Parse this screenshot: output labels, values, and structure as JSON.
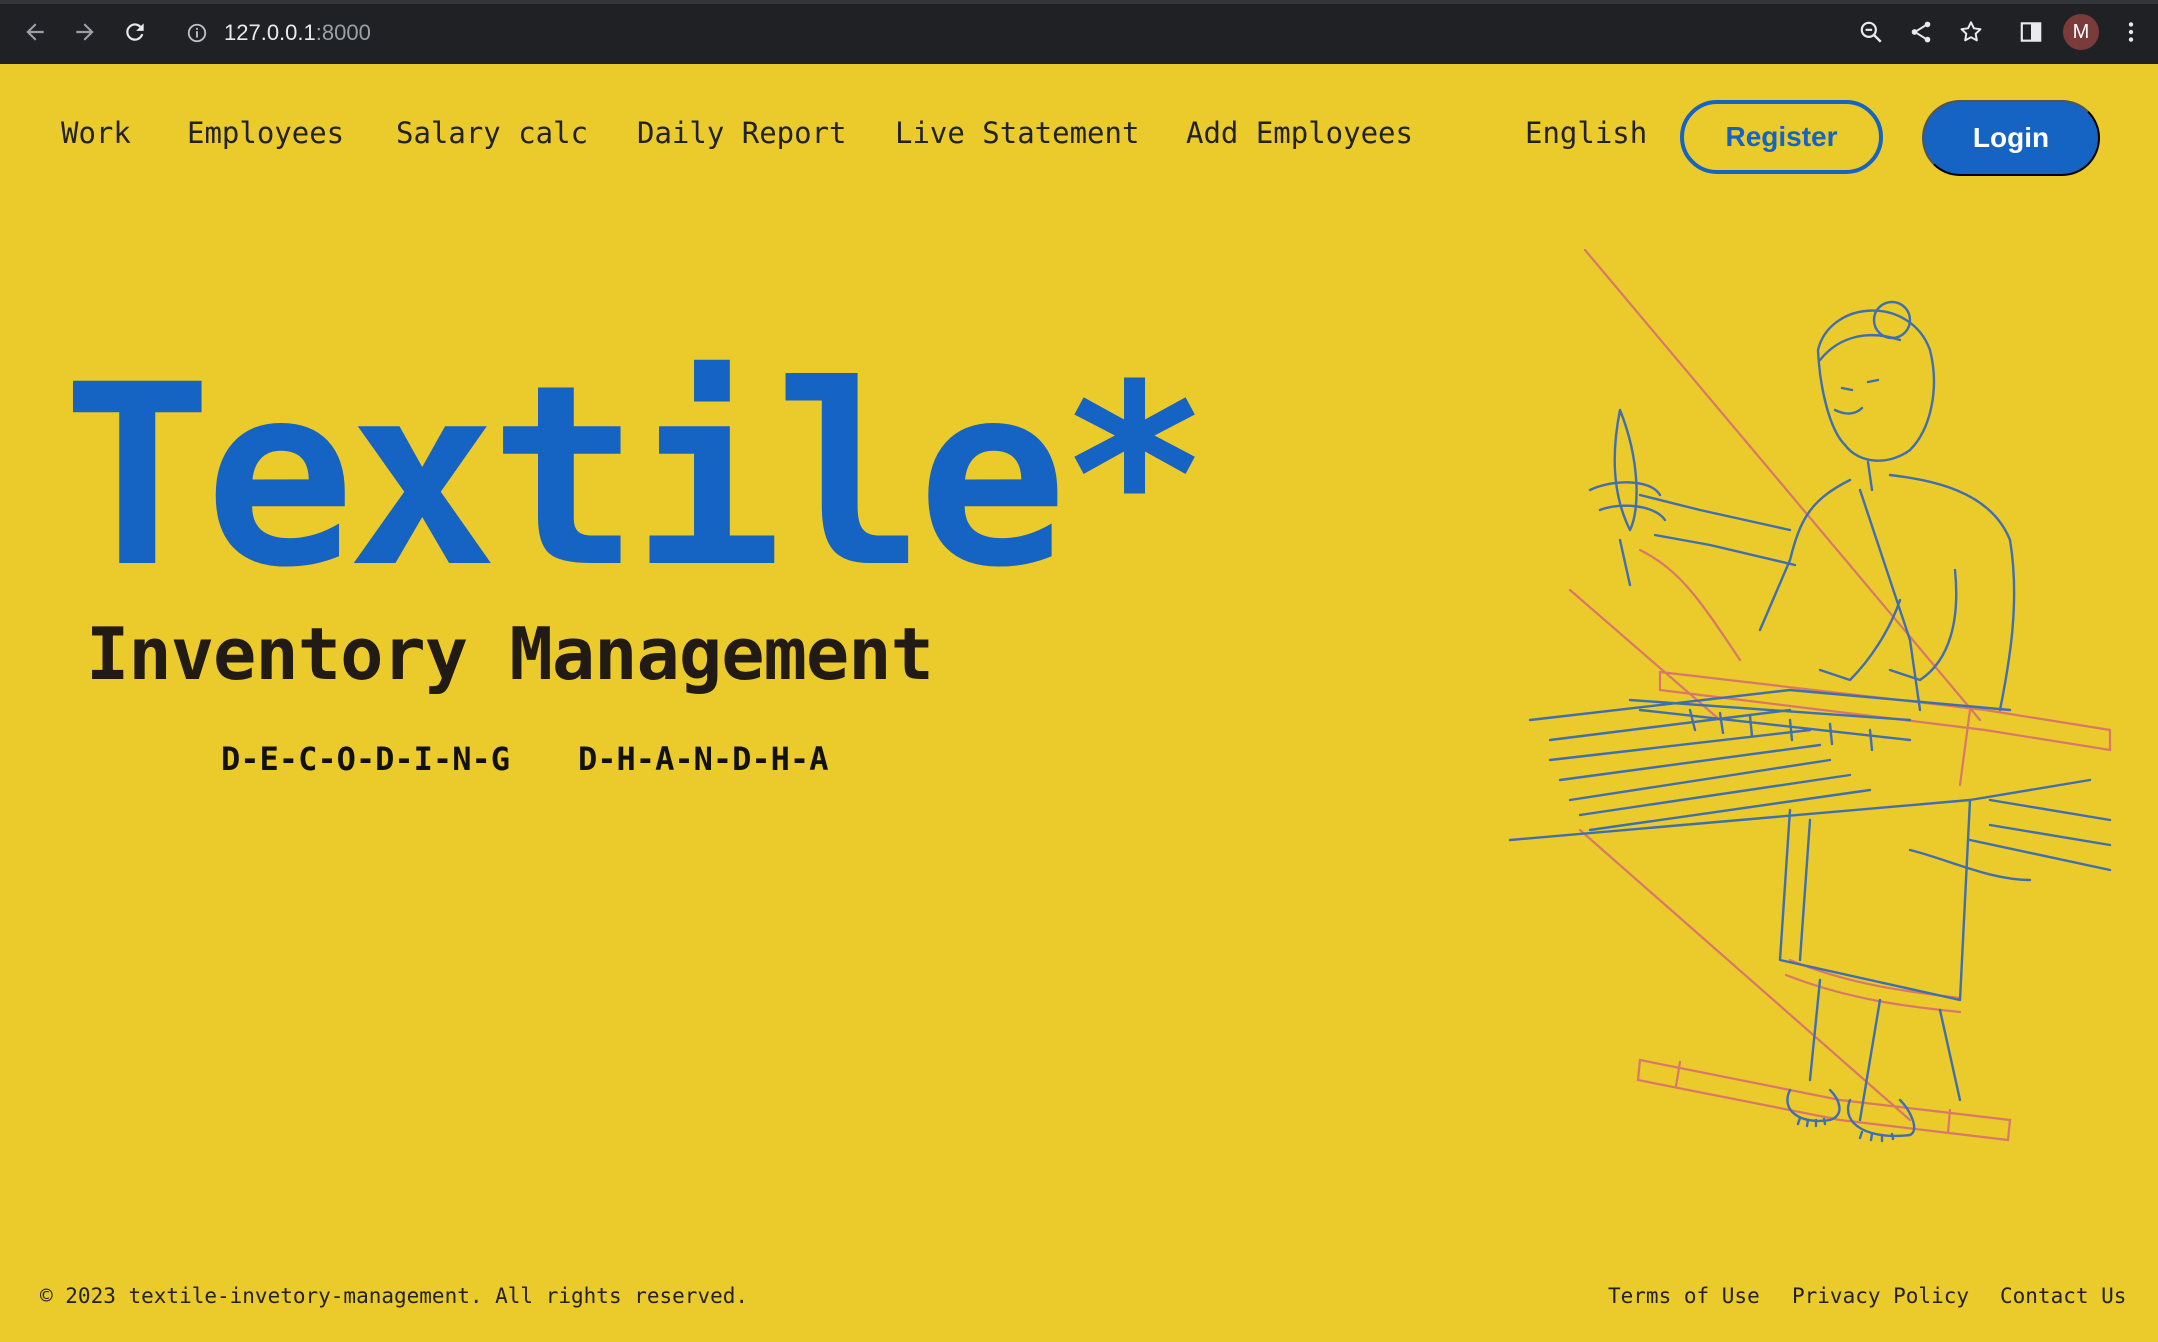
{
  "browser": {
    "url_host": "127.0.0.1",
    "url_port": ":8000",
    "profile_initial": "M",
    "icons": [
      "back-arrow-icon",
      "forward-arrow-icon",
      "reload-icon",
      "info-icon",
      "zoom-icon",
      "share-icon",
      "star-icon",
      "side-panel-icon",
      "kebab-menu-icon"
    ]
  },
  "nav": {
    "items": [
      {
        "label": "Work"
      },
      {
        "label": "Employees"
      },
      {
        "label": "Salary calc"
      },
      {
        "label": "Daily Report"
      },
      {
        "label": "Live Statement"
      },
      {
        "label": "Add Employees"
      }
    ],
    "language": "English",
    "register_label": "Register",
    "login_label": "Login"
  },
  "hero": {
    "title": "Textile*",
    "subtitle": "Inventory Management",
    "tagline_left": "D-E-C-O-D-I-N-G",
    "tagline_right": "D-H-A-N-D-H-A"
  },
  "footer": {
    "copyright": "© 2023 textile-invetory-management. All rights reserved.",
    "links": [
      {
        "label": "Terms of Use"
      },
      {
        "label": "Privacy Policy"
      },
      {
        "label": "Contact Us"
      }
    ]
  },
  "colors": {
    "background": "#ebca2c",
    "accent": "#1563c2",
    "illustration_line": "#3f6fae",
    "illustration_accent": "#d9776a"
  }
}
